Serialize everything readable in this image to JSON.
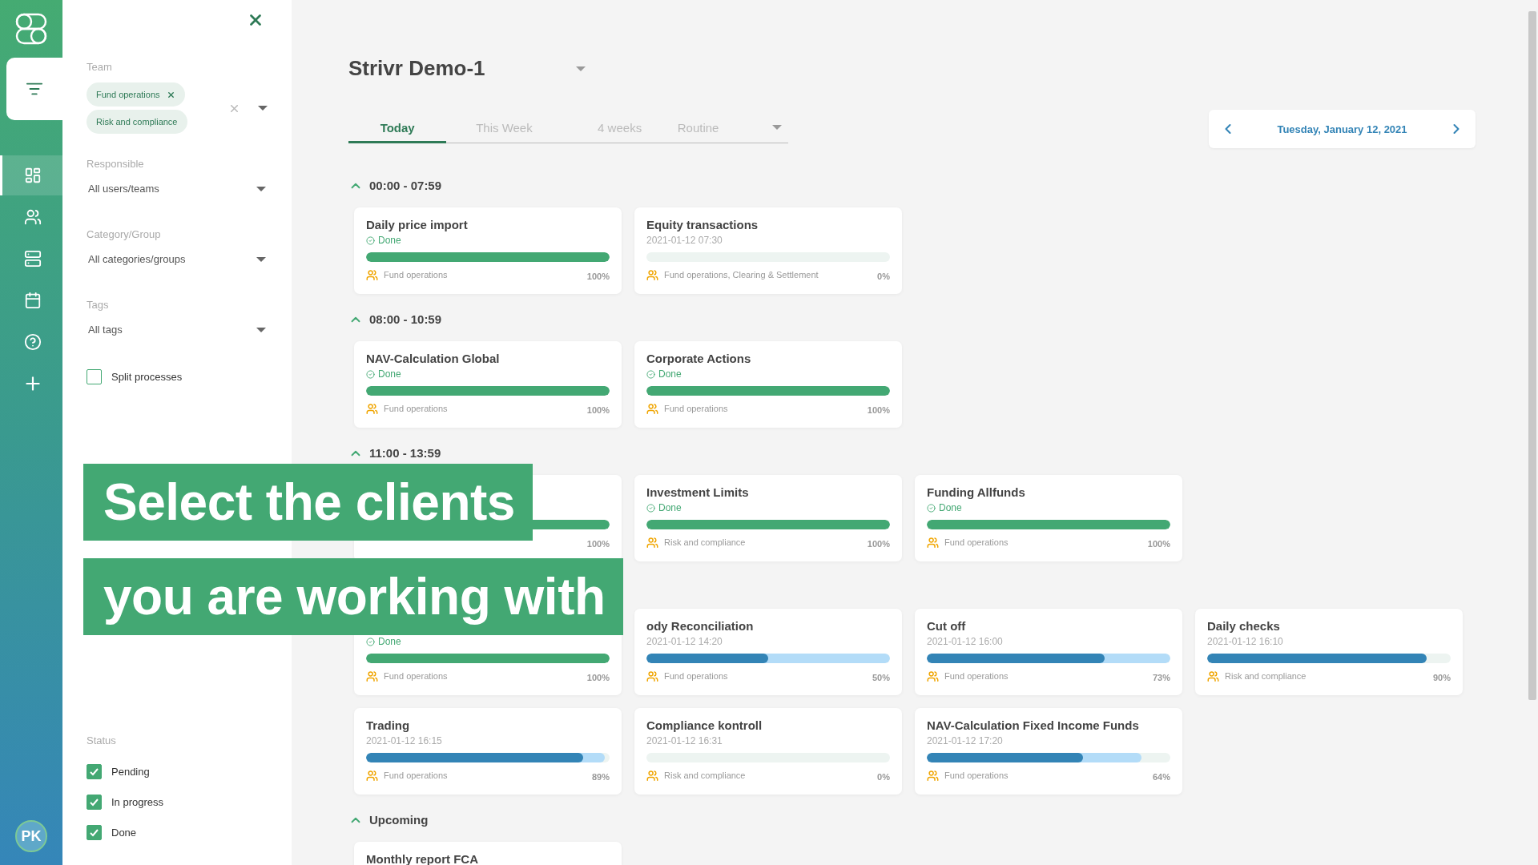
{
  "sidebar": {
    "items": [
      {
        "kind": "panel",
        "selected": true
      },
      {
        "kind": "nav",
        "selected": true
      },
      {
        "kind": "nav",
        "selected": false
      },
      {
        "kind": "nav",
        "selected": false
      },
      {
        "kind": "nav",
        "selected": false
      },
      {
        "kind": "nav",
        "selected": false
      },
      {
        "kind": "nav",
        "selected": false
      }
    ],
    "avatar": "PK"
  },
  "filters": {
    "team": {
      "label": "Team",
      "chips": [
        {
          "label": "Fund operations",
          "removable": true
        },
        {
          "label": "Risk and compliance",
          "removable": false
        }
      ]
    },
    "dropdowns": [
      {
        "label": "Responsible",
        "value": "All users/teams"
      },
      {
        "label": "Category/Group",
        "value": "All categories/groups"
      },
      {
        "label": "Tags",
        "value": "All tags"
      }
    ],
    "split": {
      "label": "Split processes",
      "checked": false
    },
    "status": {
      "label": "Status",
      "options": [
        {
          "label": "Pending",
          "checked": true
        },
        {
          "label": "In progress",
          "checked": true
        },
        {
          "label": "Done",
          "checked": true
        }
      ]
    }
  },
  "main": {
    "title": "Strivr Demo-1",
    "tabs": [
      {
        "label": "Today",
        "selected": true,
        "kind": "plain"
      },
      {
        "label": "This Week",
        "selected": false,
        "kind": "plain"
      },
      {
        "label": "4 weeks",
        "selected": false,
        "kind": "plain"
      },
      {
        "label": "Routine",
        "selected": false,
        "kind": "dropdown"
      }
    ],
    "date": "Tuesday, January 12, 2021",
    "sections": [
      {
        "title": "00:00 - 07:59",
        "expanded": true,
        "cards": [
          {
            "title": "Daily price import",
            "subtitle": "Done",
            "done": true,
            "team": "Fund operations",
            "percent": "100%",
            "bars": [
              {
                "kind": "actual",
                "level": 1
              }
            ]
          },
          {
            "title": "Equity transactions",
            "subtitle": "2021-01-12 07:30",
            "done": false,
            "team": "Fund operations, Clearing & Settlement",
            "percent": "0%",
            "bars": [
              {
                "kind": "actual",
                "level": 0
              }
            ]
          }
        ]
      },
      {
        "title": "08:00 - 10:59",
        "expanded": true,
        "cards": [
          {
            "title": "NAV-Calculation Global",
            "subtitle": "Done",
            "done": true,
            "team": "Fund operations",
            "percent": "100%",
            "bars": [
              {
                "kind": "actual",
                "level": 1
              }
            ]
          },
          {
            "title": "Corporate Actions",
            "subtitle": "Done",
            "done": true,
            "team": "Fund operations",
            "percent": "100%",
            "bars": [
              {
                "kind": "actual",
                "level": 1
              }
            ]
          }
        ]
      },
      {
        "title": "11:00 - 13:59",
        "expanded": true,
        "cards": [
          {
            "done": true,
            "percent": "100%",
            "bars": [
              {
                "kind": "actual",
                "level": 1
              }
            ]
          },
          {
            "title": "Investment Limits",
            "subtitle": "Done",
            "done": true,
            "team": "Risk and compliance",
            "percent": "100%",
            "bars": [
              {
                "kind": "actual",
                "level": 1
              }
            ]
          },
          {
            "title": "Funding Allfunds",
            "subtitle": "Done",
            "done": true,
            "team": "Fund operations",
            "percent": "100%",
            "bars": [
              {
                "kind": "actual",
                "level": 1
              }
            ]
          }
        ]
      },
      {
        "cards": [
          {
            "subtitle": "Done",
            "done": true,
            "team": "Fund operations",
            "percent": "100%",
            "bars": [
              {
                "kind": "actual",
                "level": 1
              }
            ]
          },
          {
            "title": "ody Reconciliation",
            "subtitle": "2021-01-12 14:20",
            "done": false,
            "team": "Fund operations",
            "percent": "50%",
            "bars": [
              {
                "kind": "planned",
                "level": 1
              },
              {
                "kind": "actual",
                "level": 0.5
              }
            ]
          },
          {
            "title": "Cut off",
            "subtitle": "2021-01-12 16:00",
            "done": false,
            "team": "Fund operations",
            "percent": "73%",
            "bars": [
              {
                "kind": "planned",
                "level": 1
              },
              {
                "kind": "actual",
                "level": 0.73
              }
            ]
          },
          {
            "title": "Daily checks",
            "subtitle": "2021-01-12 16:10",
            "done": false,
            "team": "Risk and compliance",
            "percent": "90%",
            "bars": [
              {
                "kind": "actual",
                "level": 0.9
              }
            ]
          },
          {
            "title": "Trading",
            "subtitle": "2021-01-12 16:15",
            "done": false,
            "team": "Fund operations",
            "percent": "89%",
            "bars": [
              {
                "kind": "planned",
                "level": 0.98
              },
              {
                "kind": "actual",
                "level": 0.89
              }
            ]
          },
          {
            "title": "Compliance kontroll",
            "subtitle": "2021-01-12 16:31",
            "done": false,
            "team": "Risk and compliance",
            "percent": "0%",
            "bars": [
              {
                "kind": "actual",
                "level": 0
              }
            ]
          },
          {
            "title": "NAV-Calculation Fixed Income Funds",
            "subtitle": "2021-01-12 17:20",
            "done": false,
            "team": "Fund operations",
            "percent": "64%",
            "bars": [
              {
                "kind": "planned",
                "level": 0.88
              },
              {
                "kind": "actual",
                "level": 0.64
              }
            ]
          }
        ]
      },
      {
        "title": "Upcoming",
        "expanded": true,
        "cards": [
          {
            "title": "Monthly report FCA"
          }
        ]
      }
    ]
  },
  "caption": {
    "lines": [
      "Select the clients",
      "you are working with"
    ]
  }
}
